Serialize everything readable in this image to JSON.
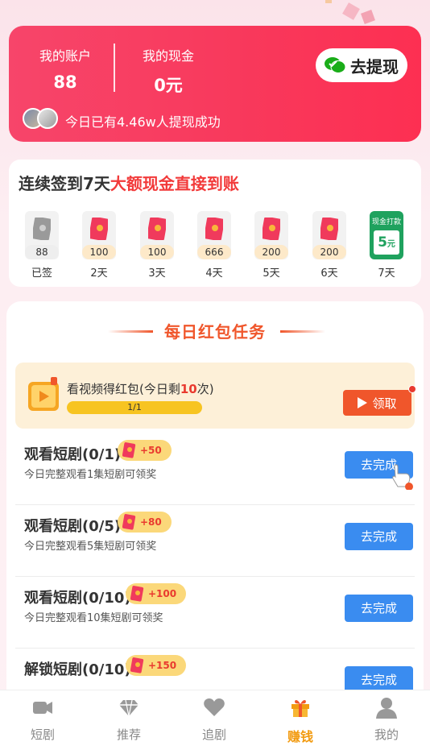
{
  "account": {
    "account_label": "我的账户",
    "account_value": "88",
    "cash_label": "我的现金",
    "cash_value": "0元",
    "withdraw_label": "去提现",
    "success_text": "今日已有4.46w人提现成功"
  },
  "signin": {
    "title_prefix": "连续签到7天",
    "title_highlight": "大额现金直接到账",
    "days": [
      {
        "amount": "88",
        "label": "已签",
        "status": "done"
      },
      {
        "amount": "100",
        "label": "2天"
      },
      {
        "amount": "100",
        "label": "3天"
      },
      {
        "amount": "666",
        "label": "4天"
      },
      {
        "amount": "200",
        "label": "5天"
      },
      {
        "amount": "200",
        "label": "6天"
      },
      {
        "label": "7天",
        "cash_title": "现金打款",
        "cash_num": "5",
        "cash_unit": "元"
      }
    ]
  },
  "tasks": {
    "header": "每日红包任务",
    "video": {
      "title_prefix": "看视频得红包(今日剩",
      "remaining": "10",
      "title_suffix": "次)",
      "progress": "1/1",
      "claim_label": "领取"
    },
    "items": [
      {
        "name": "观看短剧(0/1)",
        "reward": "+50",
        "desc": "今日完整观看1集短剧可领奖",
        "button": "去完成"
      },
      {
        "name": "观看短剧(0/5)",
        "reward": "+80",
        "desc": "今日完整观看5集短剧可领奖",
        "button": "去完成"
      },
      {
        "name": "观看短剧(0/10)",
        "reward": "+100",
        "desc": "今日完整观看10集短剧可领奖",
        "button": "去完成"
      },
      {
        "name": "解锁短剧(0/10)",
        "reward": "+150",
        "desc": "",
        "button": "去完成"
      }
    ]
  },
  "nav": {
    "items": [
      {
        "label": "短剧",
        "icon": "video-icon"
      },
      {
        "label": "推荐",
        "icon": "diamond-icon"
      },
      {
        "label": "追剧",
        "icon": "heart-icon"
      },
      {
        "label": "赚钱",
        "icon": "gift-icon",
        "active": true
      },
      {
        "label": "我的",
        "icon": "user-icon"
      }
    ]
  },
  "colors": {
    "accent_red": "#f8395c",
    "highlight_red": "#f23a3a",
    "button_blue": "#3a8cf0",
    "active_orange": "#f29b11",
    "cash_green": "#1fa25e"
  }
}
